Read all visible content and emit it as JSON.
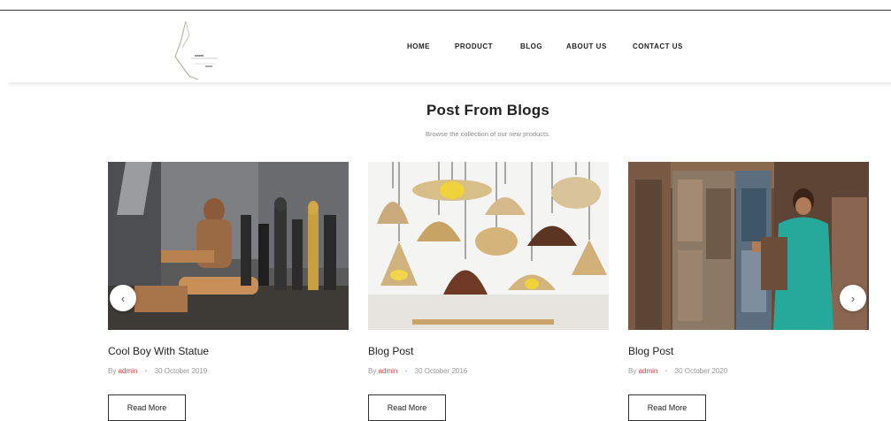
{
  "nav": {
    "items": [
      {
        "label": "HOME"
      },
      {
        "label": "PRODUCT"
      },
      {
        "label": "BLOG"
      },
      {
        "label": "ABOUT US"
      },
      {
        "label": "CONTACT US"
      }
    ]
  },
  "section": {
    "title": "Post From Blogs",
    "subtitle": "Browse the collection of our new products."
  },
  "posts": [
    {
      "title": "Cool Boy With Statue",
      "by": "By",
      "author": "admin",
      "date": "30 October 2019",
      "button": "Read More"
    },
    {
      "title": "Blog Post",
      "by": "By",
      "author": "admin",
      "date": "30 October 2016",
      "button": "Read More"
    },
    {
      "title": "Blog Post",
      "by": "By",
      "author": "admin",
      "date": "30 October 2020",
      "button": "Read More"
    }
  ],
  "carousel": {
    "prev_glyph": "‹",
    "next_glyph": "›",
    "prev_icon": "chevron-left-icon",
    "next_icon": "chevron-right-icon"
  },
  "colors": {
    "accent": "#e03a3a",
    "text": "#222222",
    "muted": "#999999"
  }
}
